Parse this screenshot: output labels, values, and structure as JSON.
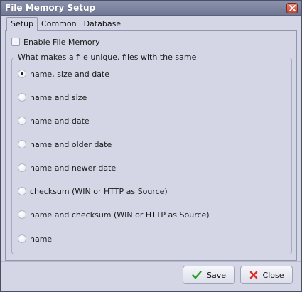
{
  "window": {
    "title": "File Memory Setup"
  },
  "tabs": [
    {
      "label": "Setup",
      "active": true
    },
    {
      "label": "Common",
      "active": false
    },
    {
      "label": "Database",
      "active": false
    }
  ],
  "setup": {
    "enable_checkbox": {
      "label": "Enable File Memory",
      "checked": false
    },
    "group_title": "What makes a file unique, files with the same",
    "options": [
      {
        "label": "name, size and date",
        "checked": true
      },
      {
        "label": "name and size",
        "checked": false
      },
      {
        "label": "name and date",
        "checked": false
      },
      {
        "label": "name and older date",
        "checked": false
      },
      {
        "label": "name and newer date",
        "checked": false
      },
      {
        "label": "checksum (WIN or HTTP as Source)",
        "checked": false
      },
      {
        "label": "name and checksum (WIN or HTTP as Source)",
        "checked": false
      },
      {
        "label": "name",
        "checked": false
      }
    ]
  },
  "buttons": {
    "save": {
      "label": "Save",
      "icon": "check-icon",
      "color": "#2e9e2e"
    },
    "close": {
      "label": "Close",
      "icon": "x-icon",
      "color": "#d9302b"
    }
  }
}
